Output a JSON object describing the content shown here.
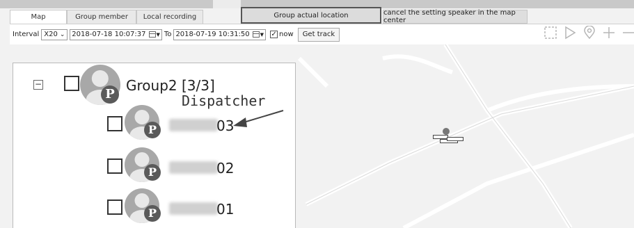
{
  "tabs": [
    {
      "label": "Map"
    },
    {
      "label": "Group member"
    },
    {
      "label": "Local recording"
    }
  ],
  "buttons": {
    "group_actual_location": "Group actual location",
    "cancel_speaker": "cancel the setting speaker in the map center"
  },
  "toolbar": {
    "interval_label": "Interval",
    "interval_value": "X20",
    "start_datetime": "2018-07-18 10:07:37",
    "to_label": "To",
    "end_datetime": "2018-07-19 10:31:50",
    "now_label": "now",
    "now_checked": true,
    "get_track_label": "Get track"
  },
  "tree": {
    "group_label": "Group2 [3/3]",
    "annotation": "Dispatcher",
    "members": [
      {
        "label_suffix": "03"
      },
      {
        "label_suffix": "02"
      },
      {
        "label_suffix": "01"
      }
    ],
    "badge_letter": "P"
  },
  "icons": [
    "selection-rect-icon",
    "play-icon",
    "location-pin-icon",
    "zoom-in-icon",
    "zoom-out-icon"
  ],
  "colors": {
    "accent": "#5a5a5a",
    "panel_border": "#b9b9b9"
  }
}
